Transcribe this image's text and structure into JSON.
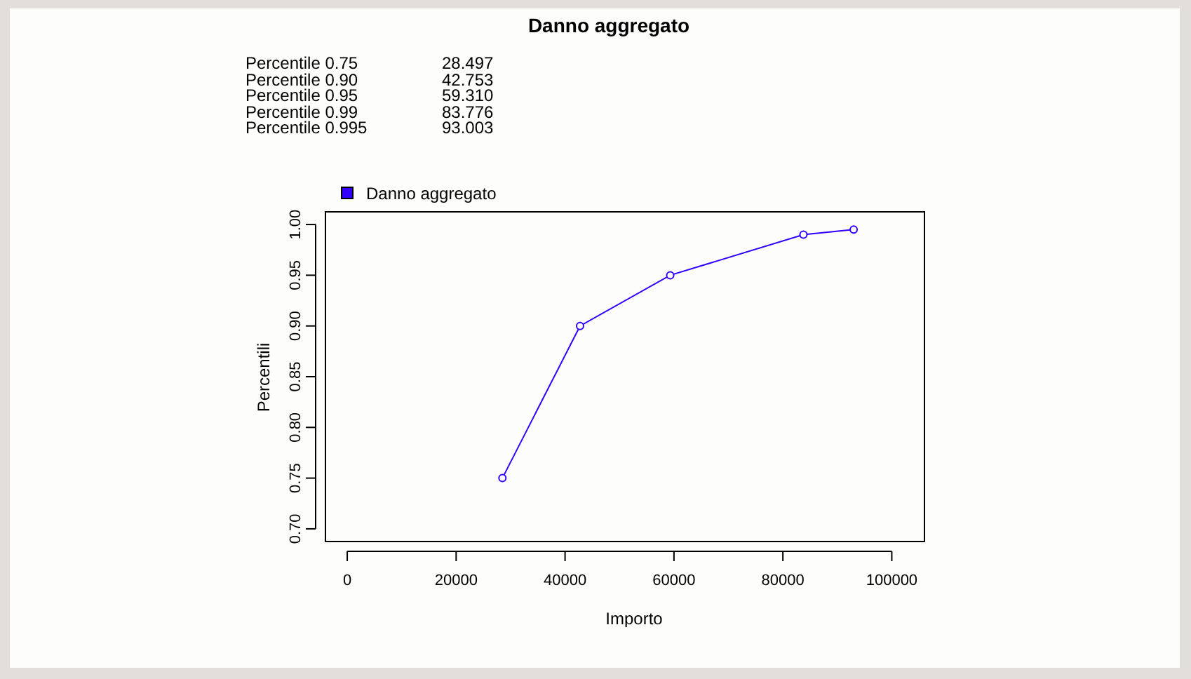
{
  "title": "Danno aggregato",
  "percentiles": [
    {
      "label": "Percentile 0.75",
      "value": "28.497"
    },
    {
      "label": "Percentile 0.90",
      "value": "42.753"
    },
    {
      "label": "Percentile 0.95",
      "value": "59.310"
    },
    {
      "label": "Percentile 0.99",
      "value": "83.776"
    },
    {
      "label": "Percentile 0.995",
      "value": "93.003"
    }
  ],
  "chart_data": {
    "type": "line",
    "xlabel": "Importo",
    "ylabel": "Percentili",
    "x": [
      28497,
      42753,
      59310,
      83776,
      93003
    ],
    "series": [
      {
        "name": "Danno aggregato",
        "color": "#3300ff",
        "marker": "circle",
        "values": [
          0.75,
          0.9,
          0.95,
          0.99,
          0.995
        ]
      }
    ],
    "xlim": [
      -4000,
      106000
    ],
    "ylim": [
      0.6875,
      1.0125
    ],
    "xticks": [
      0,
      20000,
      40000,
      60000,
      80000,
      100000
    ],
    "yticks": [
      {
        "value": 0.7,
        "label": "0.70"
      },
      {
        "value": 0.75,
        "label": "0.75"
      },
      {
        "value": 0.8,
        "label": "0.80"
      },
      {
        "value": 0.85,
        "label": "0.85"
      },
      {
        "value": 0.9,
        "label": "0.90"
      },
      {
        "value": 0.95,
        "label": "0.95"
      },
      {
        "value": 1.0,
        "label": "1.00"
      }
    ]
  }
}
